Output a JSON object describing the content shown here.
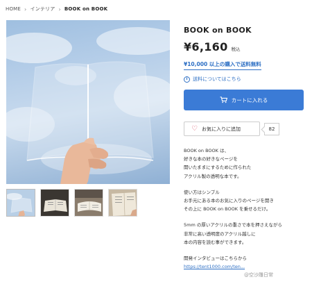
{
  "breadcrumb": {
    "items": [
      "HOME",
      "インテリア",
      "BOOK on BOOK"
    ],
    "separator": "›"
  },
  "gallery": {
    "main_image_alt": "book-on-sky-photo",
    "thumbnails": [
      "thumb-sky-book",
      "thumb-book-dark",
      "thumb-book-open",
      "thumb-book-page"
    ],
    "selected_index": 0
  },
  "product": {
    "title": "BOOK on BOOK",
    "price": "¥6,160",
    "tax_label": "税込",
    "shipping_promo": "¥10,000 以上の購入で送料無料",
    "shipping_info": "送料についてはこちら",
    "cart_label": "カートに入れる",
    "favorite_label": "お気に入りに追加",
    "favorite_count": "82"
  },
  "description": {
    "paragraph1": [
      "BOOK on BOOK は、",
      "好きな本の好きなページを",
      "開いたままにするために作られた",
      "アクリル製の透明な本です。"
    ],
    "paragraph2": [
      "使い方はシンプル",
      "お手元にある本のお気に入りのページを開き",
      "その上に BOOK on BOOK を乗せるだけ。"
    ],
    "paragraph3": [
      "5mm の厚いアクリルの重さで本を押さえながら",
      "非常に高い透明度のアクリル越しに",
      "本の内容を読む事ができます。"
    ],
    "paragraph4": [
      "開発インタビューはこちらから"
    ],
    "link_text": "https://tent1000.com/ten..."
  },
  "watermark": "@空沙雕日常",
  "colors": {
    "accent_blue": "#3b7bd6",
    "link_blue": "#2d6fc4",
    "heart_red": "#d9556a"
  }
}
